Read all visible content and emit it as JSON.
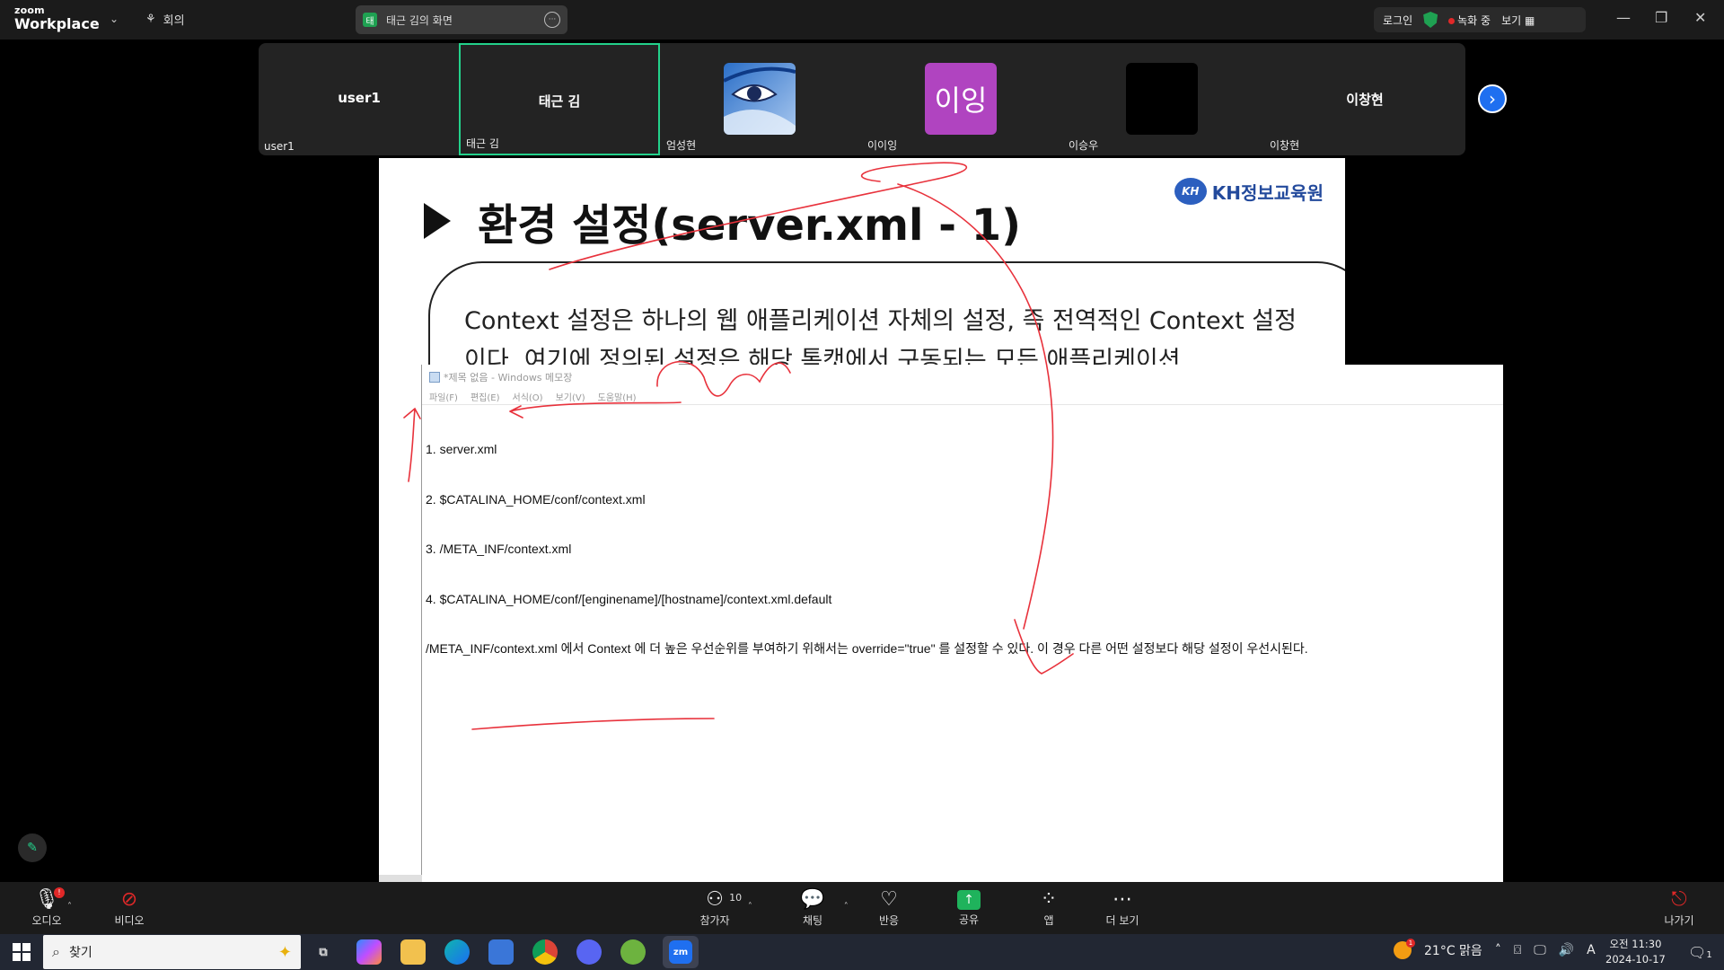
{
  "app": {
    "brand_small": "zoom",
    "brand_name": "Workplace",
    "meeting_label": "회의",
    "share_source": "태근 김의 화면",
    "login_label": "로그인",
    "recording_label": "녹화 중",
    "view_label": "보기"
  },
  "participants": [
    {
      "label": "user1",
      "center_name": "user1",
      "avatar_type": "none"
    },
    {
      "label": "태근 김",
      "center_name": "태근 김",
      "avatar_type": "none",
      "active_speaker": true
    },
    {
      "label": "엄성현",
      "center_name": "",
      "avatar_type": "image"
    },
    {
      "label": "이이잉",
      "center_name": "",
      "avatar_type": "text",
      "avatar_text": "이잉",
      "avatar_color": "#b044c0"
    },
    {
      "label": "이승우",
      "center_name": "",
      "avatar_type": "black"
    },
    {
      "label": "이창현",
      "center_name": "이창현",
      "avatar_type": "none"
    }
  ],
  "slide": {
    "title": "환경 설정(server.xml - 1)",
    "logo_mark": "KH",
    "logo_text": "KH정보교육원",
    "body": "Context 설정은 하나의 웹 애플리케이션 자체의 설정, 즉 전역적인 Context 설정이다. 여기에 정의된 설정은 해당 톰캣에서 구동되는 모든 애플리케이션"
  },
  "notepad": {
    "title": "*제목 없음 - Windows 메모장",
    "menu": [
      "파일(F)",
      "편집(E)",
      "서식(O)",
      "보기(V)",
      "도움말(H)"
    ],
    "lines": [
      "1. server.xml",
      "2. $CATALINA_HOME/conf/context.xml",
      "3. /META_INF/context.xml",
      "4. $CATALINA_HOME/conf/[enginename]/[hostname]/context.xml.default",
      "/META_INF/context.xml 에서 Context 에 더 높은 우선순위를 부여하기 위해서는 override=\"true\" 를 설정할 수 있다. 이 경우 다른 어떤 설정보다 해당 설정이 우선시된다."
    ]
  },
  "toolbar": {
    "audio": "오디오",
    "video": "비디오",
    "participants": "참가자",
    "participants_count": "10",
    "chat": "채팅",
    "reactions": "반응",
    "share": "공유",
    "apps": "앱",
    "more": "더 보기",
    "leave": "나가기"
  },
  "taskbar": {
    "search_placeholder": "찾기",
    "weather": "21°C  맑음",
    "weather_badge": "1",
    "time": "오전 11:30",
    "date": "2024-10-17",
    "ime": "A",
    "notif_count": "1",
    "apps": [
      "task-view",
      "copilot",
      "file-explorer",
      "edge",
      "store",
      "chrome",
      "discord",
      "spring-tool",
      "zoom"
    ]
  },
  "colors": {
    "accent_green": "#23d18b",
    "zoom_blue": "#1f6ff0",
    "record_red": "#e02828",
    "ink_red": "#e8323c"
  }
}
